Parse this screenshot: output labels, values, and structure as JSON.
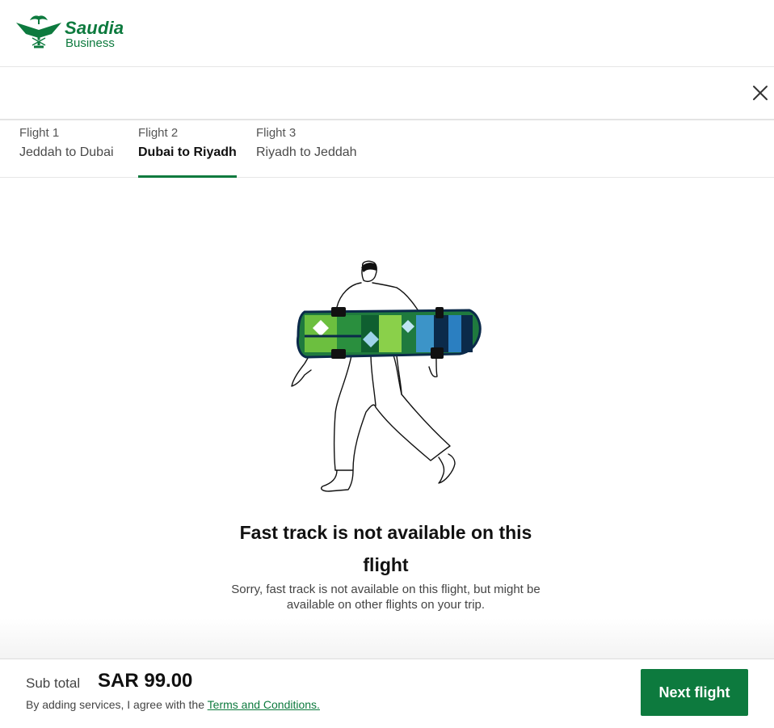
{
  "brand": {
    "name": "Saudia",
    "sub": "Business",
    "color": "#0d7a3e",
    "icon": "palm-swords-logo-icon"
  },
  "panel": {
    "close_icon": "close-icon"
  },
  "tabs": [
    {
      "kicker": "Flight 1",
      "route": "Jeddah to Dubai",
      "active": false
    },
    {
      "kicker": "Flight 2",
      "route": "Dubai to Riyadh",
      "active": true
    },
    {
      "kicker": "Flight 3",
      "route": "Riyadh to Jeddah",
      "active": false
    }
  ],
  "empty_state": {
    "illustration": "person-carrying-skateboard-illustration",
    "title": "Fast track is not available on this flight",
    "description": "Sorry, fast track is not available on this flight, but might be available on other flights on your trip."
  },
  "footer": {
    "subtotal_label": "Sub total",
    "subtotal_value": "SAR 99.00",
    "terms_prefix": "By adding services, I agree with the",
    "terms_link": "Terms and Conditions.",
    "next_button": "Next flight"
  }
}
